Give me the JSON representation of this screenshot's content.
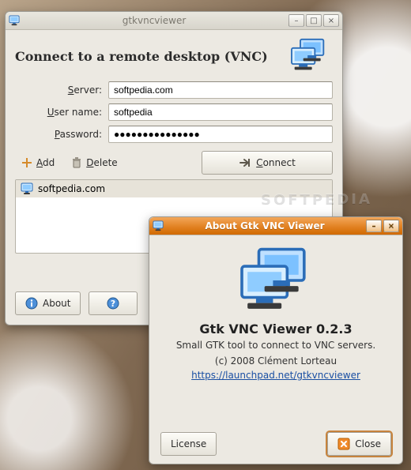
{
  "watermark": "SOFTPEDIA",
  "main": {
    "title": "gtkvncviewer",
    "heading": "Connect to a remote desktop (VNC)",
    "labels": {
      "server": "Server:",
      "username": "User name:",
      "password": "Password:"
    },
    "mnemonic": {
      "server": "S",
      "username": "U",
      "password": "P"
    },
    "form": {
      "server": "softpedia.com",
      "username": "softpedia",
      "password": "●●●●●●●●●●●●●●●"
    },
    "buttons": {
      "add": "Add",
      "add_mnemonic": "A",
      "delete": "Delete",
      "delete_mnemonic": "D",
      "connect": "Connect",
      "connect_mnemonic": "C",
      "about": "About",
      "help": ""
    },
    "servers": [
      "softpedia.com"
    ]
  },
  "about": {
    "title": "About Gtk VNC Viewer",
    "app_name": "Gtk VNC Viewer 0.2.3",
    "subtitle": "Small GTK tool to connect to VNC servers.",
    "copyright": "(c) 2008 Clément Lorteau",
    "url": "https://launchpad.net/gtkvncviewer",
    "buttons": {
      "license": "License",
      "close": "Close"
    }
  },
  "icons": {
    "info": "info-icon",
    "help": "help-icon",
    "add": "add-icon",
    "delete": "delete-icon",
    "connect": "connect-icon",
    "close": "close-icon",
    "monitors": "monitors-icon",
    "server": "server-icon",
    "app": "app-icon"
  }
}
